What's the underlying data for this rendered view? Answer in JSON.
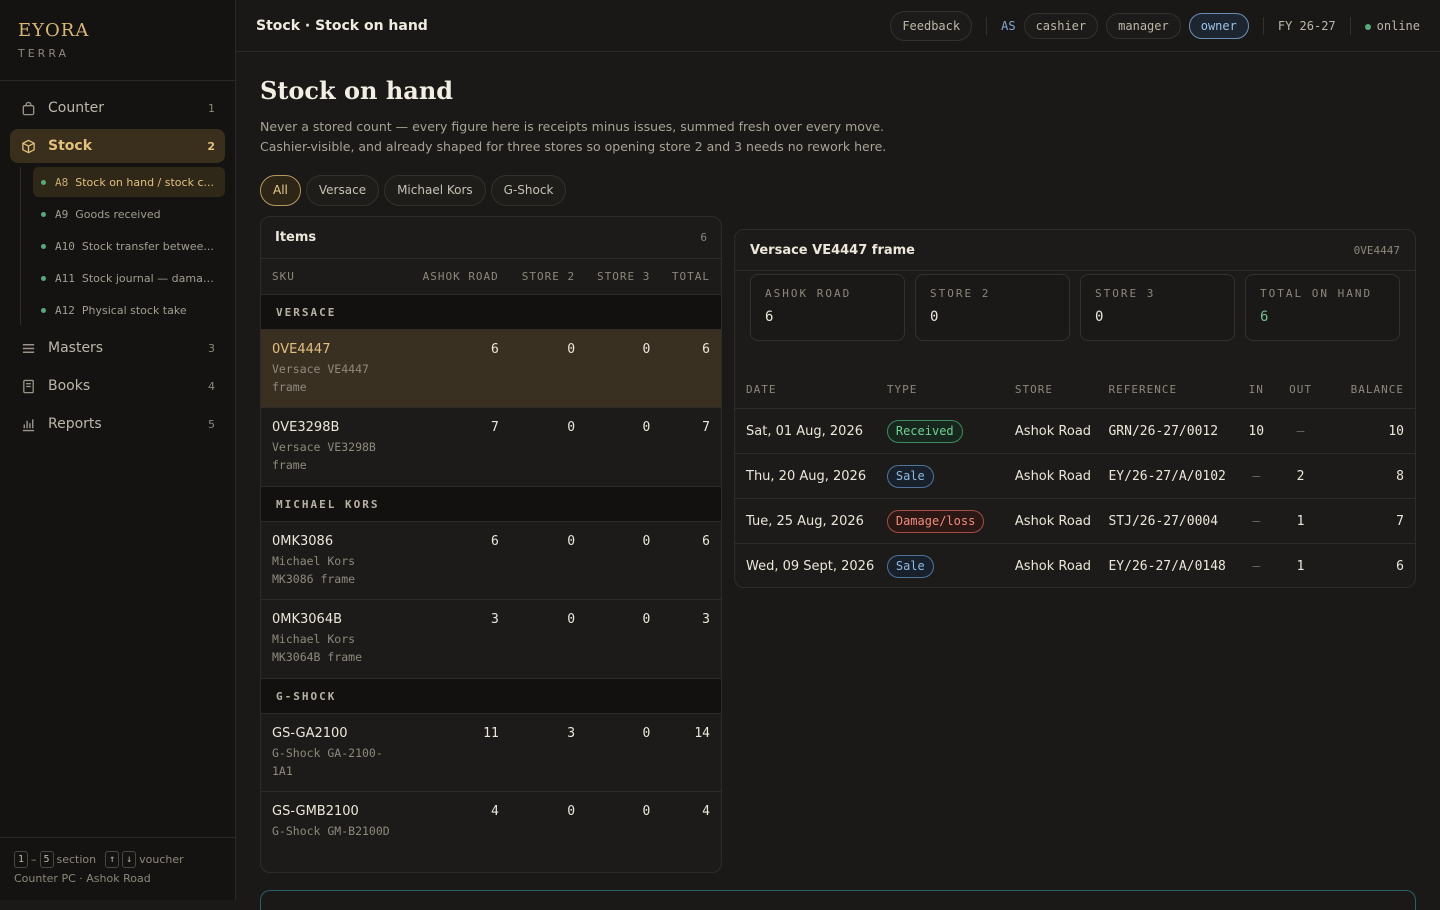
{
  "brand": {
    "name": "EYORA",
    "sub": "TERRA"
  },
  "nav": {
    "counter": {
      "label": "Counter",
      "count": "1"
    },
    "stock": {
      "label": "Stock",
      "count": "2"
    },
    "sub": [
      {
        "code": "A8",
        "label": "Stock on hand / stock c..."
      },
      {
        "code": "A9",
        "label": "Goods received"
      },
      {
        "code": "A10",
        "label": "Stock transfer betwee..."
      },
      {
        "code": "A11",
        "label": "Stock journal — damag..."
      },
      {
        "code": "A12",
        "label": "Physical stock take"
      }
    ],
    "masters": {
      "label": "Masters",
      "count": "3"
    },
    "books": {
      "label": "Books",
      "count": "4"
    },
    "reports": {
      "label": "Reports",
      "count": "5"
    }
  },
  "footer": {
    "key1": "1",
    "dash": "–",
    "key5": "5",
    "section": "section",
    "up": "↑",
    "down": "↓",
    "voucher": "voucher",
    "location": "Counter PC · Ashok Road"
  },
  "topbar": {
    "breadcrumb": "Stock · Stock on hand",
    "feedback": "Feedback",
    "as_label": "AS",
    "roles": [
      "cashier",
      "manager",
      "owner"
    ],
    "fy": "FY 26-27",
    "status": "online"
  },
  "page": {
    "title": "Stock on hand",
    "desc1": "Never a stored count — every figure here is receipts minus issues, summed fresh over every move.",
    "desc2": "Cashier-visible, and already shaped for three stores so opening store 2 and 3 needs no rework here."
  },
  "filters": [
    "All",
    "Versace",
    "Michael Kors",
    "G-Shock"
  ],
  "items": {
    "title": "Items",
    "count": "6",
    "columns": [
      "SKU",
      "ASHOK ROAD",
      "STORE 2",
      "STORE 3",
      "TOTAL"
    ],
    "groups": [
      {
        "name": "VERSACE",
        "rows": [
          {
            "sku": "0VE4447",
            "name": "Versace VE4447 frame",
            "a": "6",
            "s2": "0",
            "s3": "0",
            "t": "6"
          },
          {
            "sku": "0VE3298B",
            "name": "Versace VE3298B frame",
            "a": "7",
            "s2": "0",
            "s3": "0",
            "t": "7"
          }
        ]
      },
      {
        "name": "MICHAEL KORS",
        "rows": [
          {
            "sku": "0MK3086",
            "name": "Michael Kors MK3086 frame",
            "a": "6",
            "s2": "0",
            "s3": "0",
            "t": "6"
          },
          {
            "sku": "0MK3064B",
            "name": "Michael Kors MK3064B frame",
            "a": "3",
            "s2": "0",
            "s3": "0",
            "t": "3"
          }
        ]
      },
      {
        "name": "G-SHOCK",
        "rows": [
          {
            "sku": "GS-GA2100",
            "name": "G-Shock GA-2100-1A1",
            "a": "11",
            "s2": "3",
            "s3": "0",
            "t": "14"
          },
          {
            "sku": "GS-GMB2100",
            "name": "G-Shock GM-B2100D",
            "a": "4",
            "s2": "0",
            "s3": "0",
            "t": "4"
          }
        ]
      }
    ]
  },
  "detail": {
    "title": "Versace VE4447 frame",
    "code": "0VE4447",
    "cards": [
      {
        "label": "ASHOK ROAD",
        "value": "6"
      },
      {
        "label": "STORE 2",
        "value": "0"
      },
      {
        "label": "STORE 3",
        "value": "0"
      },
      {
        "label": "TOTAL ON HAND",
        "value": "6"
      }
    ],
    "columns": [
      "DATE",
      "TYPE",
      "STORE",
      "REFERENCE",
      "IN",
      "OUT",
      "BALANCE"
    ],
    "rows": [
      {
        "date": "Sat, 01 Aug, 2026",
        "type": "Received",
        "store": "Ashok Road",
        "ref": "GRN/26-27/0012",
        "in": "10",
        "out": "—",
        "bal": "10"
      },
      {
        "date": "Thu, 20 Aug, 2026",
        "type": "Sale",
        "store": "Ashok Road",
        "ref": "EY/26-27/A/0102",
        "in": "—",
        "out": "2",
        "bal": "8"
      },
      {
        "date": "Tue, 25 Aug, 2026",
        "type": "Damage/loss",
        "store": "Ashok Road",
        "ref": "STJ/26-27/0004",
        "in": "—",
        "out": "1",
        "bal": "7"
      },
      {
        "date": "Wed, 09 Sept, 2026",
        "type": "Sale",
        "store": "Ashok Road",
        "ref": "EY/26-27/A/0148",
        "in": "—",
        "out": "1",
        "bal": "6"
      }
    ]
  }
}
